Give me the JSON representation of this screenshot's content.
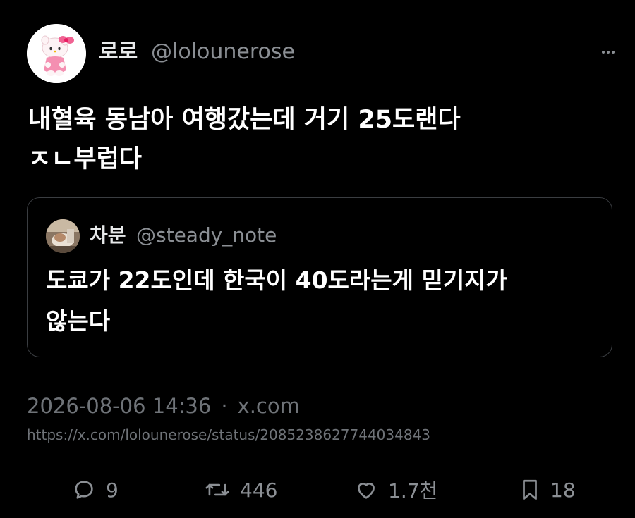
{
  "tweet": {
    "author": {
      "display_name": "로로",
      "handle": "@lolounerose",
      "avatar": "hello-kitty-avatar"
    },
    "text_lines": [
      "내혈육 동남아 여행갔는데 거기 25도랜다",
      "ㅈㄴ부럽다"
    ],
    "quote": {
      "author": {
        "display_name": "차분",
        "handle": "@steady_note",
        "avatar": "photo-avatar"
      },
      "text_lines": [
        "도쿄가 22도인데 한국이 40도라는게 믿기지가",
        "않는다"
      ]
    },
    "timestamp": "2026-08-06 14:36",
    "separator": "·",
    "source": "x.com",
    "url": "https://x.com/lolounerose/status/2085238627744034843",
    "stats": {
      "replies": "9",
      "reposts": "446",
      "likes": "1.7천",
      "bookmarks": "18"
    },
    "icons": {
      "more": "more-icon",
      "reply": "reply-icon",
      "repost": "repost-icon",
      "like": "heart-icon",
      "bookmark": "bookmark-icon"
    }
  },
  "colors": {
    "background": "#000000",
    "primary_text": "#ffffff",
    "secondary_text": "#8b8f94",
    "border": "#3a3d41",
    "avatar_accent": "#f06292"
  }
}
